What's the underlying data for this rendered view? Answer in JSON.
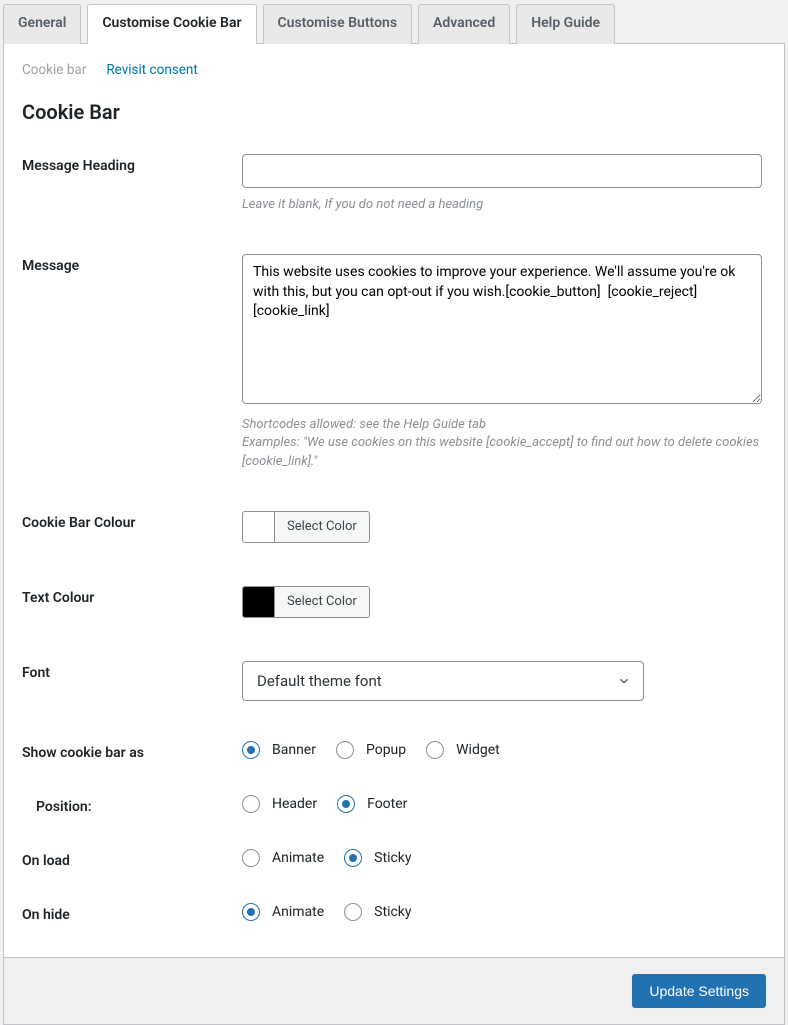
{
  "tabs": [
    {
      "label": "General"
    },
    {
      "label": "Customise Cookie Bar",
      "active": true
    },
    {
      "label": "Customise Buttons"
    },
    {
      "label": "Advanced"
    },
    {
      "label": "Help Guide"
    }
  ],
  "subtabs": [
    {
      "label": "Cookie bar",
      "current": true
    },
    {
      "label": "Revisit consent"
    }
  ],
  "section_title": "Cookie Bar",
  "fields": {
    "message_heading": {
      "label": "Message Heading",
      "value": "",
      "help": "Leave it blank, If you do not need a heading"
    },
    "message": {
      "label": "Message",
      "value": "This website uses cookies to improve your experience. We'll assume you're ok with this, but you can opt-out if you wish.[cookie_button]  [cookie_reject] [cookie_link]",
      "help": "Shortcodes allowed: see the Help Guide tab\nExamples: \"We use cookies on this website [cookie_accept] to find out how to delete cookies [cookie_link].\""
    },
    "cookie_bar_colour": {
      "label": "Cookie Bar Colour",
      "button_text": "Select Color",
      "swatch": "#ffffff"
    },
    "text_colour": {
      "label": "Text Colour",
      "button_text": "Select Color",
      "swatch": "#000000"
    },
    "font": {
      "label": "Font",
      "selected": "Default theme font"
    },
    "show_as": {
      "label": "Show cookie bar as",
      "options": [
        "Banner",
        "Popup",
        "Widget"
      ],
      "value": "Banner"
    },
    "position": {
      "label": "Position:",
      "options": [
        "Header",
        "Footer"
      ],
      "value": "Footer"
    },
    "on_load": {
      "label": "On load",
      "options": [
        "Animate",
        "Sticky"
      ],
      "value": "Sticky"
    },
    "on_hide": {
      "label": "On hide",
      "options": [
        "Animate",
        "Sticky"
      ],
      "value": "Animate"
    }
  },
  "footer": {
    "update_label": "Update Settings"
  }
}
